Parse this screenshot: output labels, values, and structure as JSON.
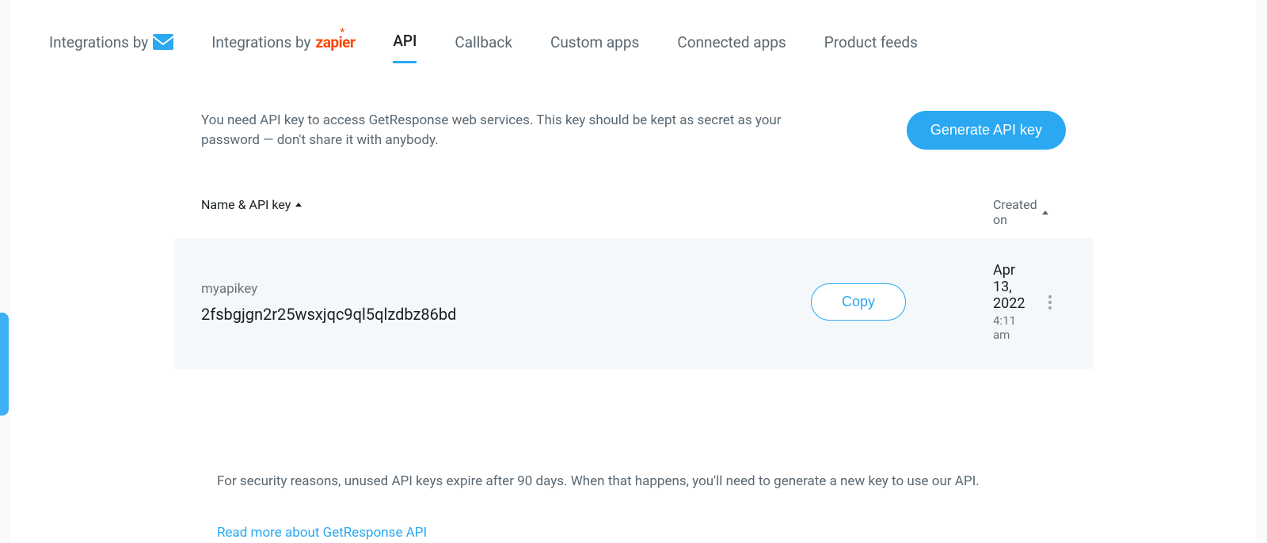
{
  "tabs": {
    "integrations_by_prefix": "Integrations by",
    "api": "API",
    "callback": "Callback",
    "custom_apps": "Custom apps",
    "connected_apps": "Connected apps",
    "product_feeds": "Product feeds",
    "zapier_brand": "zapier"
  },
  "intro": "You need API key to access GetResponse web services. This key should be kept as secret as your password — don't share it with anybody.",
  "generate_label": "Generate API key",
  "columns": {
    "name": "Name & API key",
    "created": "Created on"
  },
  "keys": [
    {
      "name": "myapikey",
      "value": "2fsbgjgn2r25wsxjqc9ql5qlzdbz86bd",
      "copy_label": "Copy",
      "created_date": "Apr 13, 2022",
      "created_time": "4:11 am"
    }
  ],
  "footer": {
    "note": "For security reasons, unused API keys expire after 90 days. When that happens, you'll need to generate a new key to use our API.",
    "link": "Read more about GetResponse API"
  }
}
